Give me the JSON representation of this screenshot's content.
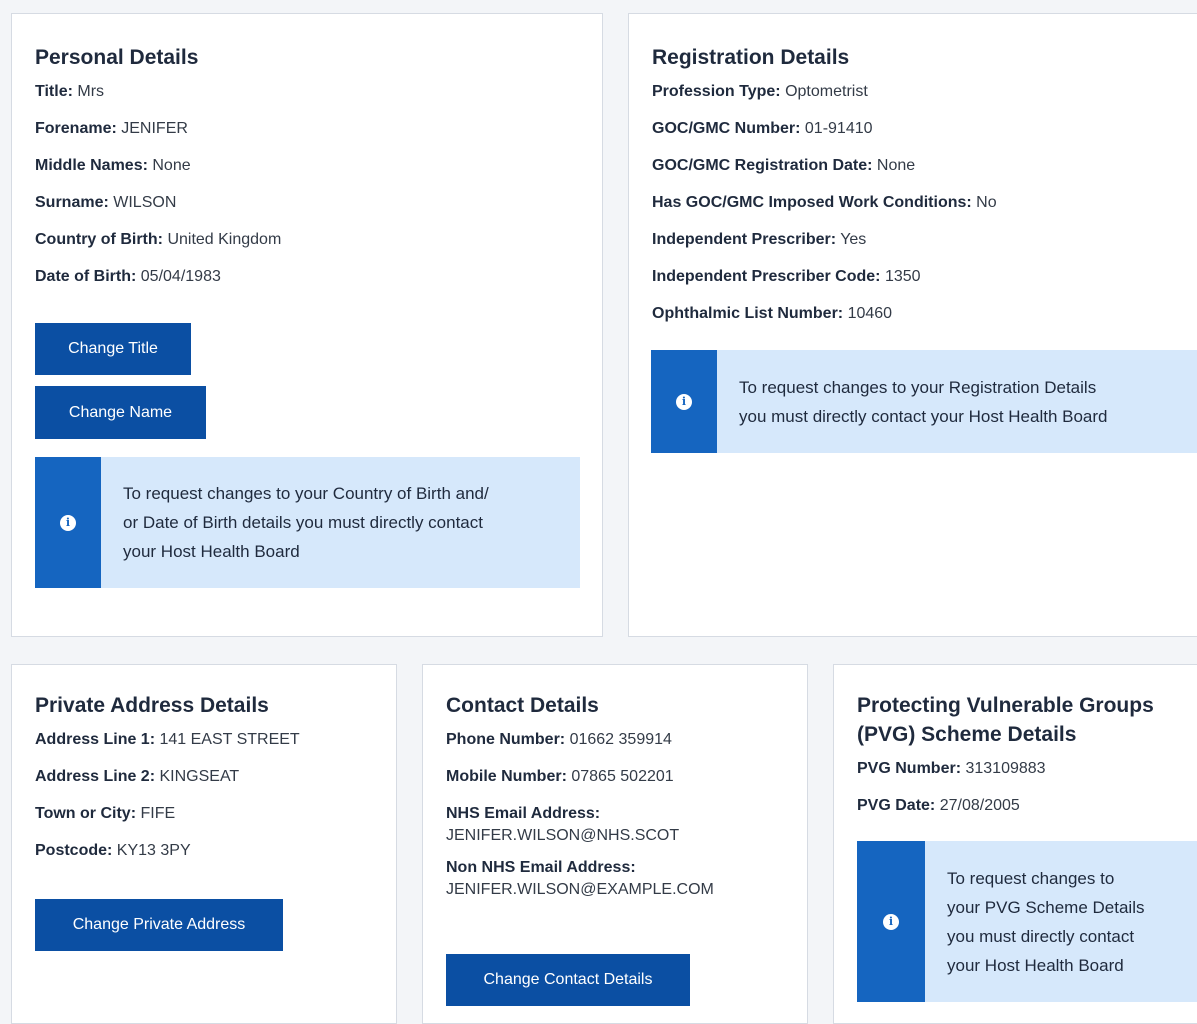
{
  "personal": {
    "heading": "Personal Details",
    "fields": [
      {
        "label": "Title:",
        "value": "Mrs"
      },
      {
        "label": "Forename:",
        "value": "JENIFER"
      },
      {
        "label": "Middle Names:",
        "value": "None"
      },
      {
        "label": "Surname:",
        "value": "WILSON"
      },
      {
        "label": "Country of Birth:",
        "value": "United Kingdom"
      },
      {
        "label": "Date of Birth:",
        "value": "05/04/1983"
      }
    ],
    "change_title_label": "Change Title",
    "change_name_label": "Change Name",
    "info_line1": "To request changes to your Country of Birth and/",
    "info_line2": "or Date of Birth details you must directly contact",
    "info_line3": "your Host Health Board"
  },
  "registration": {
    "heading": "Registration Details",
    "fields": [
      {
        "label": "Profession Type:",
        "value": "Optometrist"
      },
      {
        "label": "GOC/GMC Number:",
        "value": "01-91410"
      },
      {
        "label": "GOC/GMC Registration Date:",
        "value": "None"
      },
      {
        "label": "Has GOC/GMC Imposed Work Conditions:",
        "value": "No"
      },
      {
        "label": "Independent Prescriber:",
        "value": "Yes"
      },
      {
        "label": "Independent Prescriber Code:",
        "value": "1350"
      },
      {
        "label": "Ophthalmic List Number:",
        "value": "10460"
      }
    ],
    "info_line1": "To request changes to your Registration Details",
    "info_line2": "you must directly contact your Host Health Board"
  },
  "address": {
    "heading": "Private Address Details",
    "fields": [
      {
        "label": "Address Line 1:",
        "value": "141 EAST STREET"
      },
      {
        "label": "Address Line 2:",
        "value": "KINGSEAT"
      },
      {
        "label": "Town or City:",
        "value": "FIFE"
      },
      {
        "label": "Postcode:",
        "value": "KY13 3PY"
      }
    ],
    "change_label": "Change Private Address"
  },
  "contact": {
    "heading": "Contact Details",
    "phone_label": "Phone Number:",
    "phone_value": "01662 359914",
    "mobile_label": "Mobile Number:",
    "mobile_value": "07865 502201",
    "nhs_email_label": "NHS Email Address:",
    "nhs_email_value": "JENIFER.WILSON@NHS.SCOT",
    "other_email_label": "Non NHS Email Address:",
    "other_email_value": "JENIFER.WILSON@EXAMPLE.COM",
    "change_label": "Change Contact Details"
  },
  "pvg": {
    "heading_line1": "Protecting Vulnerable Groups",
    "heading_line2": "(PVG) Scheme Details",
    "number_label": "PVG Number:",
    "number_value": "313109883",
    "date_label": "PVG Date:",
    "date_value": "27/08/2005",
    "info_line1": "To request changes to",
    "info_line2": "your PVG Scheme Details",
    "info_line3": "you must directly contact",
    "info_line4": "your Host Health Board"
  },
  "icons": {
    "info": "info-icon"
  },
  "colors": {
    "button": "#0b4fa3",
    "info_bar": "#1565c0",
    "info_bg": "#d6e8fb"
  }
}
